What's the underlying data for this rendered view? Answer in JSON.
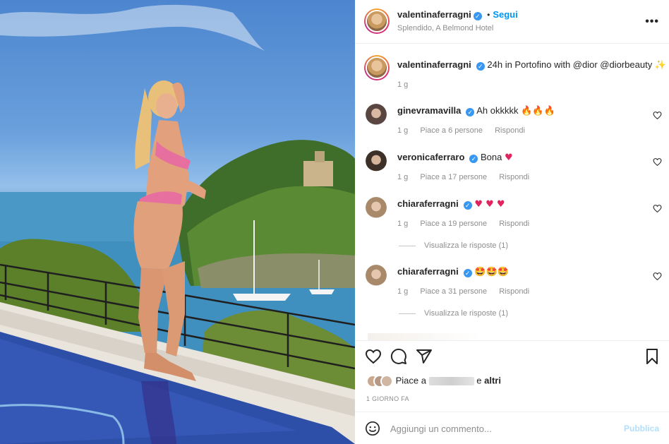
{
  "post": {
    "author": "valentinaferragni",
    "follow_label": "Segui",
    "dot": "•",
    "location": "Splendido, A Belmond Hotel",
    "more_label": "•••",
    "caption_text": "24h in Portofino with @dior @diorbeauty",
    "caption_emoji": "✨",
    "caption_time": "1 g",
    "verified_mark": "✓"
  },
  "comments": [
    {
      "user": "ginevramavilla",
      "text": "Ah okkkkk",
      "emoji": "🔥🔥🔥",
      "time": "1 g",
      "likes": "Piace a 6 persone",
      "reply": "Rispondi",
      "replies": ""
    },
    {
      "user": "veronicaferraro",
      "text": "Bona",
      "emoji": "♥",
      "time": "1 g",
      "likes": "Piace a 17 persone",
      "reply": "Rispondi",
      "replies": ""
    },
    {
      "user": "chiaraferragni",
      "text": "",
      "emoji": "♥ ♥ ♥",
      "time": "1 g",
      "likes": "Piace a 19 persone",
      "reply": "Rispondi",
      "replies": "Visualizza le risposte (1)"
    },
    {
      "user": "chiaraferragni",
      "text": "",
      "emoji": "🤩🤩🤩",
      "time": "1 g",
      "likes": "Piace a 31 persone",
      "reply": "Rispondi",
      "replies": "Visualizza le risposte (1)"
    }
  ],
  "likes": {
    "prefix": "Piace a",
    "and": "e",
    "others": "altri"
  },
  "time_ago": "1 GIORNO FA",
  "composer": {
    "placeholder": "Aggiungi un commento...",
    "publish_label": "Pubblica"
  },
  "colors": {
    "accent": "#0095f6",
    "verified": "#3897f0",
    "heart_red": "#e0245e",
    "publish_disabled": "#b2dffc"
  },
  "icons": [
    "heart-icon",
    "comment-icon",
    "share-icon",
    "bookmark-icon",
    "emoji-icon",
    "more-icon",
    "verified-icon"
  ]
}
